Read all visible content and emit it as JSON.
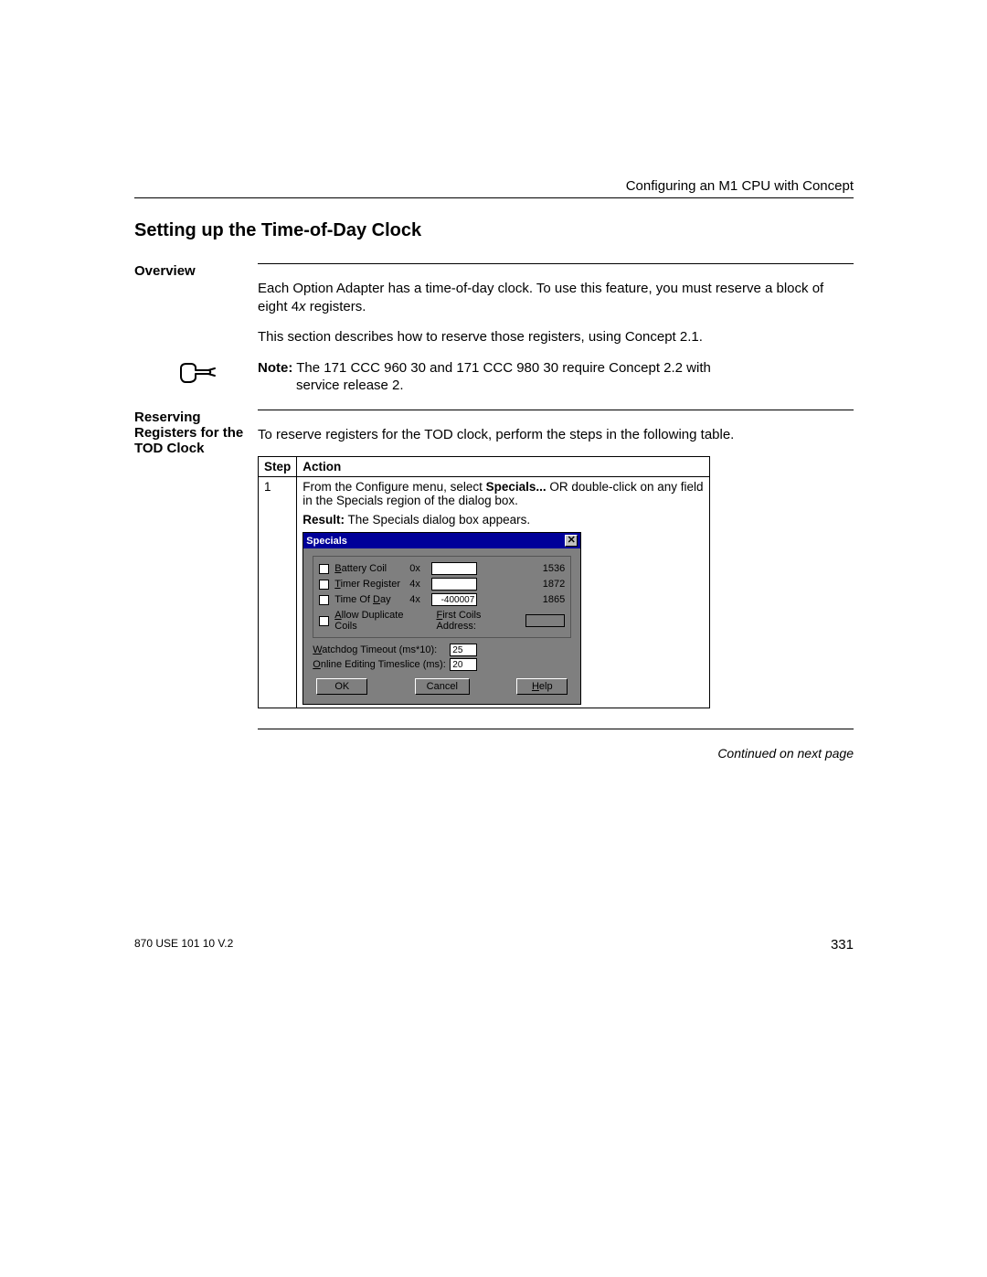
{
  "header_right": "Configuring an M1 CPU with Concept",
  "title": "Setting up the Time-of-Day Clock",
  "overview_label": "Overview",
  "overview_p1_a": "Each Option Adapter has a time-of-day clock. To use this feature, you must reserve a block of eight 4",
  "overview_p1_ix": "x",
  "overview_p1_b": " registers.",
  "overview_p2": "This section describes how to reserve those registers, using Concept 2.1.",
  "note_prefix": "Note:",
  "note_text": "The 171 CCC 960 30 and 171 CCC 980 30 require Concept 2.2 with",
  "note_sub": "service release 2.",
  "reserving_label_l1": "Reserving",
  "reserving_label_l2": "Registers for the",
  "reserving_label_l3": "TOD Clock",
  "reserving_intro": "To reserve registers for the TOD clock, perform the steps in the following table.",
  "table": {
    "th_step": "Step",
    "th_action": "Action",
    "step1_no": "1",
    "step1_a": "From the Configure menu, select ",
    "step1_b": "Specials...",
    "step1_c": " OR double-click on any field in the Specials region of the dialog box.",
    "step1_result_prefix": "Result:",
    "step1_result": " The Specials dialog box appears."
  },
  "dialog": {
    "title": "Specials",
    "battery_label": "Battery Coil",
    "timer_label": "Timer Register",
    "tod_label": "Time Of Day",
    "battery_prefix": "0x",
    "timer_prefix": "4x",
    "tod_prefix": "4x",
    "battery_val": "",
    "timer_val": "",
    "tod_val": "-400007",
    "battery_avail": "1536",
    "timer_avail": "1872",
    "tod_avail": "1865",
    "allow_dup": "Allow Duplicate Coils",
    "first_coils": "First Coils Address:",
    "watchdog_label": "Watchdog Timeout (ms*10):",
    "watchdog_val": "25",
    "timeslice_label": "Online Editing Timeslice (ms):",
    "timeslice_val": "20",
    "ok": "OK",
    "cancel": "Cancel",
    "help": "Help"
  },
  "continued": "Continued on next page",
  "footer_left": "870 USE 101 10 V.2",
  "footer_right": "331"
}
